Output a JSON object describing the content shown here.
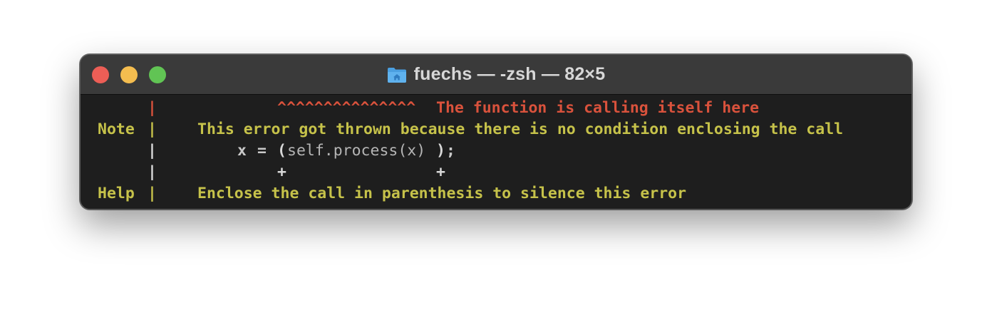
{
  "window": {
    "title": "fuechs — -zsh — 82×5",
    "folder_icon": "folder-home-icon",
    "buttons": {
      "close": "close-button",
      "minimize": "minimize-button",
      "zoom": "zoom-button"
    },
    "colors": {
      "close": "#ec5e56",
      "minimize": "#f4bd4f",
      "zoom": "#61c454"
    }
  },
  "terminal": {
    "line1": {
      "gutter": "|",
      "carets": "^^^^^^^^^^^^^^^",
      "message": "The function is calling itself here"
    },
    "line2": {
      "label": "Note",
      "gutter": "|",
      "message": "This error got thrown because there is no condition enclosing the call"
    },
    "line3": {
      "gutter": "|",
      "code_var": "x",
      "code_eq": "=",
      "code_open": "(",
      "code_body": "self.process(x)",
      "code_close": ")",
      "code_semi": ";"
    },
    "line4": {
      "gutter": "|",
      "plus_left": "+",
      "plus_right": "+"
    },
    "line5": {
      "label": "Help",
      "gutter": "|",
      "message": "Enclose the call in parenthesis to silence this error"
    },
    "colors": {
      "error": "#d9523c",
      "note": "#c6c24a",
      "code": "#b5b5b5",
      "background": "#1e1e1e"
    }
  }
}
